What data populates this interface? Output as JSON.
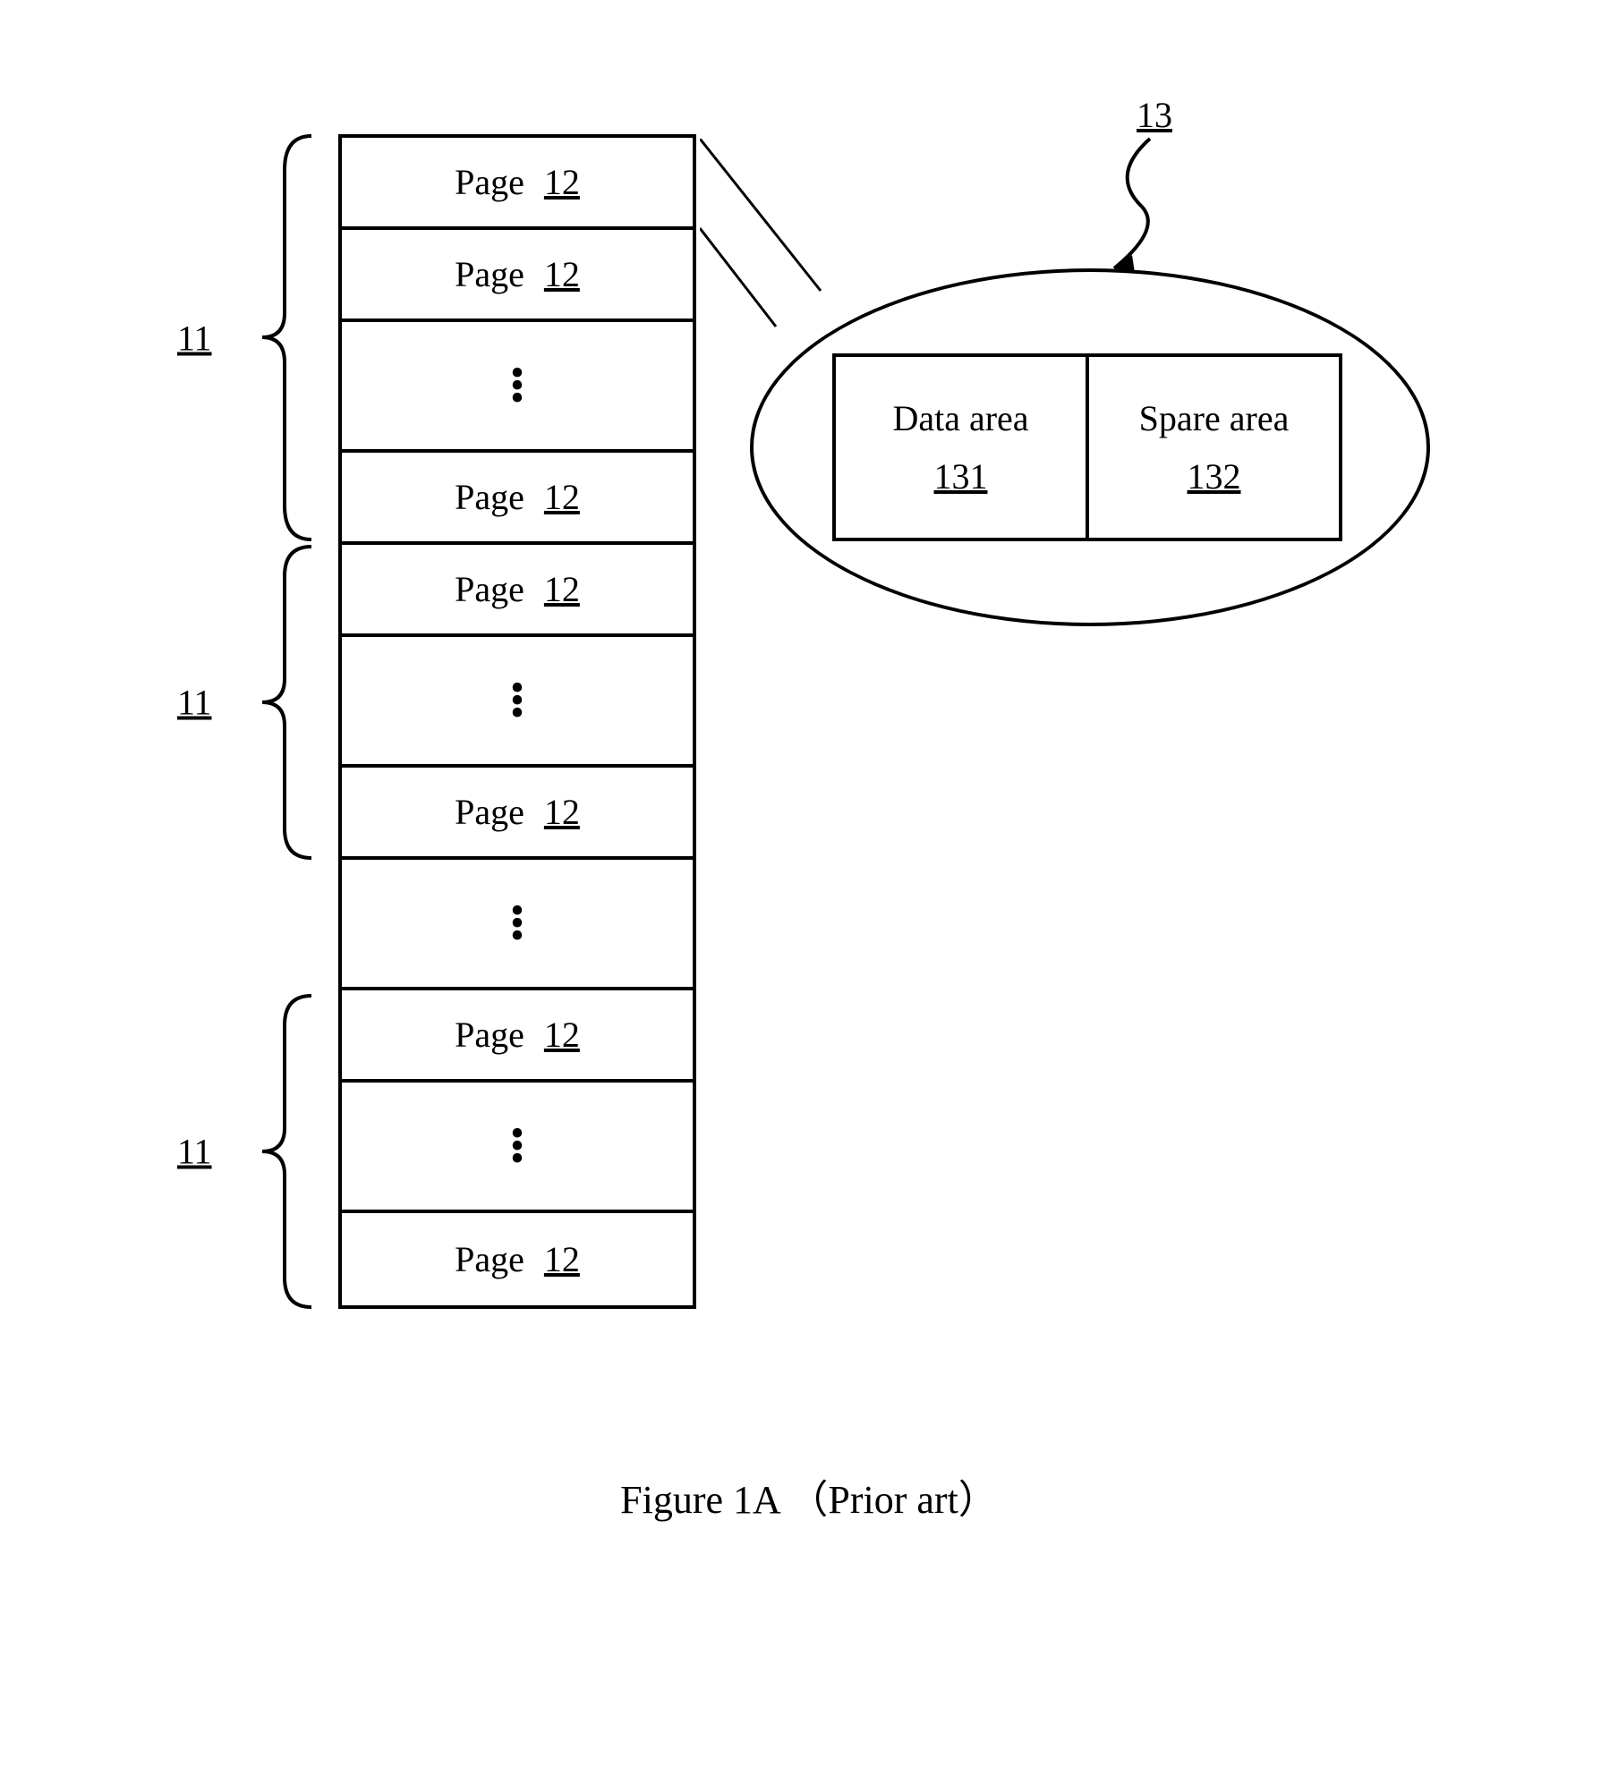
{
  "blocks": {
    "label": "11",
    "page_label": "Page",
    "page_ref": "12"
  },
  "sector": {
    "ref": "13",
    "data_label": "Data area",
    "data_ref": "131",
    "spare_label": "Spare area",
    "spare_ref": "132"
  },
  "caption": "Figure 1A （Prior art）"
}
